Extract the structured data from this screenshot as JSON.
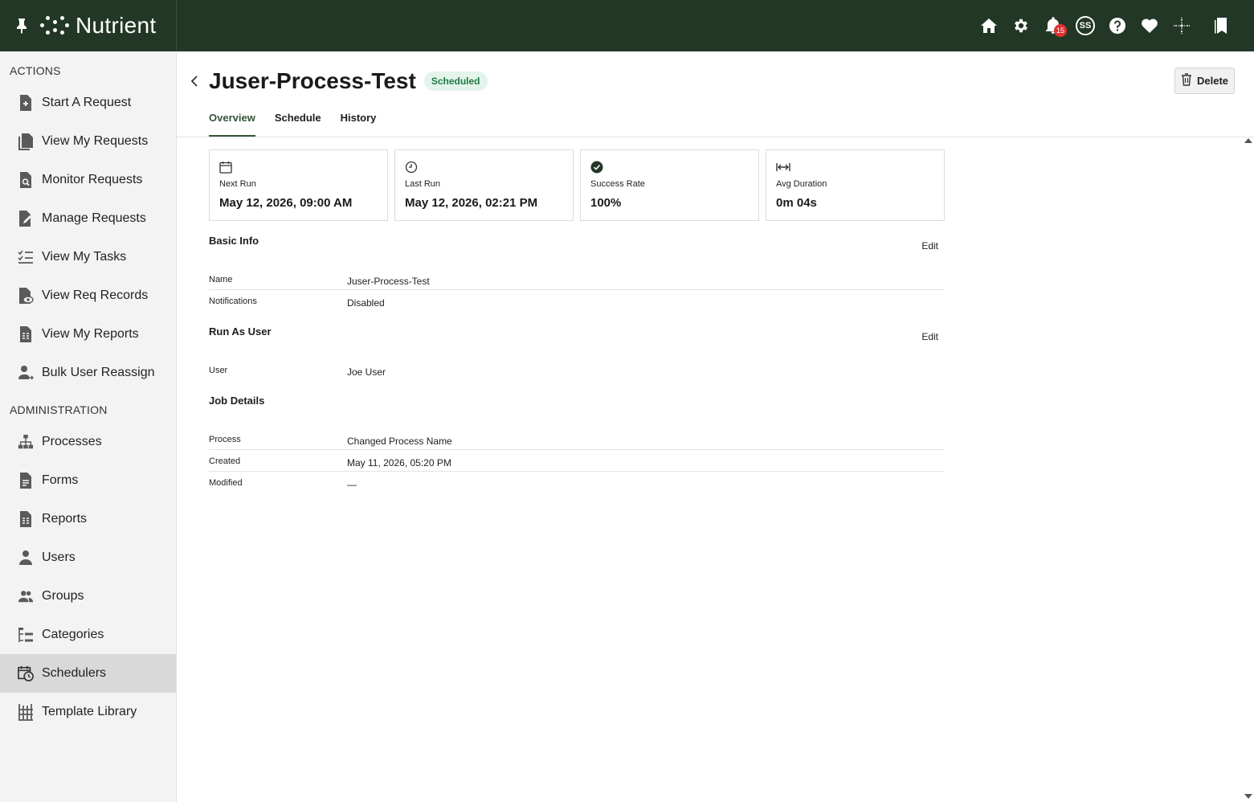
{
  "brand": {
    "name": "Nutrient"
  },
  "topbar": {
    "notification_count": "15",
    "avatar_initials": "SS"
  },
  "sidebar": {
    "actions_title": "ACTIONS",
    "actions": [
      {
        "label": "Start A Request",
        "icon": "file-plus-icon"
      },
      {
        "label": "View My Requests",
        "icon": "documents-icon"
      },
      {
        "label": "Monitor Requests",
        "icon": "file-search-icon"
      },
      {
        "label": "Manage Requests",
        "icon": "file-edit-icon"
      },
      {
        "label": "View My Tasks",
        "icon": "checklist-icon"
      },
      {
        "label": "View Req Records",
        "icon": "file-eye-icon"
      },
      {
        "label": "View My Reports",
        "icon": "report-icon"
      },
      {
        "label": "Bulk User Reassign",
        "icon": "user-reassign-icon"
      }
    ],
    "admin_title": "ADMINISTRATION",
    "admin": [
      {
        "label": "Processes",
        "icon": "hierarchy-icon"
      },
      {
        "label": "Forms",
        "icon": "form-icon"
      },
      {
        "label": "Reports",
        "icon": "report-icon"
      },
      {
        "label": "Users",
        "icon": "user-icon"
      },
      {
        "label": "Groups",
        "icon": "group-icon"
      },
      {
        "label": "Categories",
        "icon": "categories-icon"
      },
      {
        "label": "Schedulers",
        "icon": "calendar-clock-icon",
        "active": true
      },
      {
        "label": "Template Library",
        "icon": "library-icon"
      }
    ]
  },
  "page": {
    "title": "Juser-Process-Test",
    "status": "Scheduled",
    "delete_label": "Delete"
  },
  "tabs": [
    {
      "label": "Overview",
      "active": true
    },
    {
      "label": "Schedule"
    },
    {
      "label": "History"
    }
  ],
  "cards": [
    {
      "label": "Next Run",
      "value": "May 12, 2026, 09:00 AM",
      "icon": "calendar-icon"
    },
    {
      "label": "Last Run",
      "value": "May 12, 2026, 02:21 PM",
      "icon": "clock-icon"
    },
    {
      "label": "Success Rate",
      "value": "100%",
      "icon": "check-circle-icon"
    },
    {
      "label": "Avg Duration",
      "value": "0m 04s",
      "icon": "width-arrows-icon"
    }
  ],
  "basic_info": {
    "title": "Basic Info",
    "edit_label": "Edit",
    "rows": [
      {
        "label": "Name",
        "value": "Juser-Process-Test"
      },
      {
        "label": "Notifications",
        "value": "Disabled"
      }
    ]
  },
  "run_as": {
    "title": "Run As User",
    "edit_label": "Edit",
    "rows": [
      {
        "label": "User",
        "value": "Joe User"
      }
    ]
  },
  "job_details": {
    "title": "Job Details",
    "rows": [
      {
        "label": "Process",
        "value": "Changed Process Name"
      },
      {
        "label": "Created",
        "value": "May 11, 2026, 05:20 PM"
      },
      {
        "label": "Modified",
        "value": "—"
      }
    ]
  },
  "colors": {
    "topbar": "#233726",
    "accent": "#355438",
    "status_bg": "#e3f4ea",
    "status_text": "#1f7a45",
    "badge": "#e03131"
  }
}
